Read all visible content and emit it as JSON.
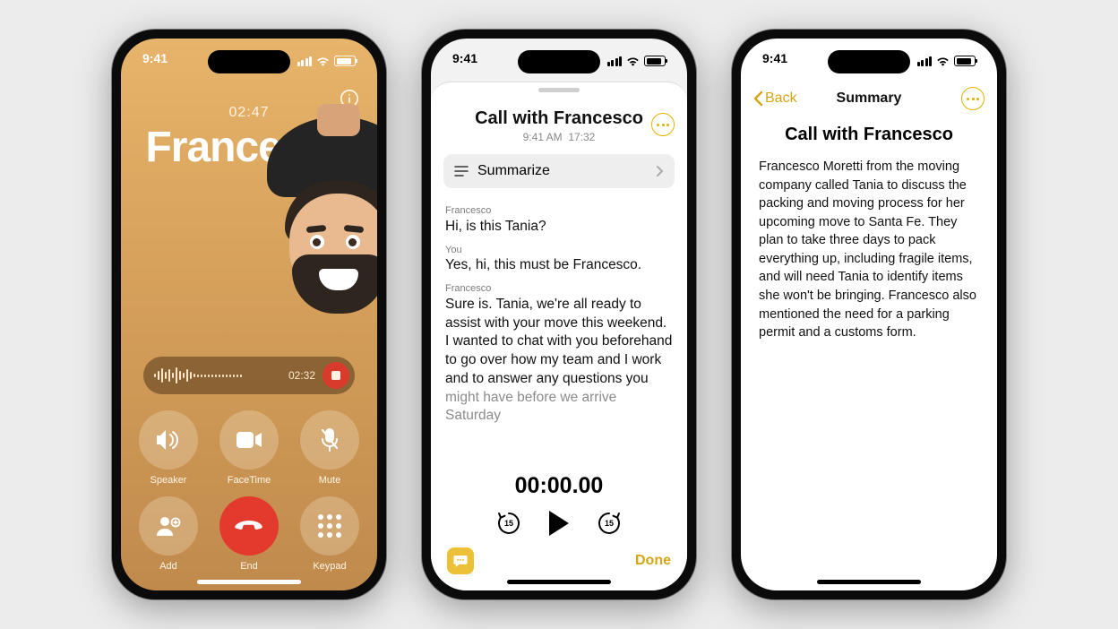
{
  "status": {
    "time": "9:41"
  },
  "call": {
    "duration": "02:47",
    "name": "Francesco",
    "recording_time": "02:32",
    "controls": {
      "speaker": "Speaker",
      "facetime": "FaceTime",
      "mute": "Mute",
      "add": "Add",
      "end": "End",
      "keypad": "Keypad"
    }
  },
  "transcript": {
    "title": "Call with Francesco",
    "subtitle_time": "9:41 AM",
    "subtitle_dur": "17:32",
    "summarize_label": "Summarize",
    "lines": [
      {
        "speaker": "Francesco",
        "text": "Hi, is this Tania?"
      },
      {
        "speaker": "You",
        "text": "Yes, hi, this must be Francesco."
      },
      {
        "speaker": "Francesco",
        "text": "Sure is. Tania, we're all ready to assist with your move this weekend. I wanted to chat with you beforehand to go over how my team and I work and to answer any questions you"
      },
      {
        "speaker": "",
        "text": "might have before we arrive Saturday"
      }
    ],
    "player_time": "00:00.00",
    "skip_amount": "15",
    "done_label": "Done"
  },
  "summary": {
    "back_label": "Back",
    "nav_title": "Summary",
    "title": "Call with Francesco",
    "body": "Francesco Moretti from the moving company called Tania to discuss the packing and moving process for her upcoming move to Santa Fe. They plan to take three days to pack everything up, including fragile items, and will need Tania to identify items she won't be bringing. Francesco also mentioned the need for a parking permit and a customs form."
  }
}
